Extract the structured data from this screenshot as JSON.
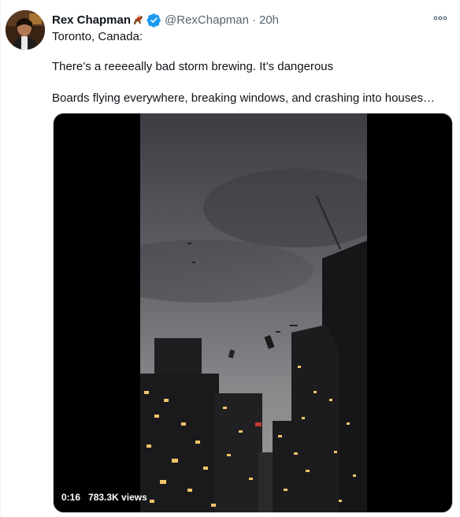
{
  "tweet": {
    "display_name": "Rex Chapman",
    "handle": "@RexChapman",
    "separator": "·",
    "time": "20h",
    "line1": "Toronto, Canada:",
    "line2": "There’s a reeeeally bad storm brewing. It’s dangerous",
    "line3": "Boards flying everywhere, breaking windows, and crashing into houses…"
  },
  "video": {
    "duration": "0:16",
    "views": "783.3K views"
  },
  "colors": {
    "verified": "#1d9bf0",
    "secondary_text": "#536471",
    "primary_text": "#0f1419"
  },
  "icons": {
    "verified": "verified-badge-icon",
    "more": "more-options-icon",
    "emoji": "horse-racing-emoji"
  }
}
